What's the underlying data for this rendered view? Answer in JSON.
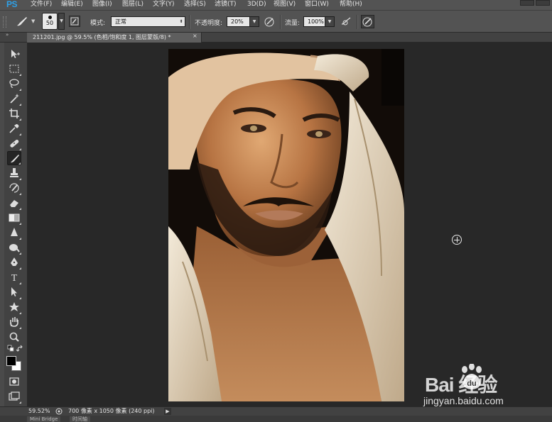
{
  "app": {
    "logo": "PS"
  },
  "menu": {
    "items": [
      {
        "label": "文件(F)"
      },
      {
        "label": "编辑(E)"
      },
      {
        "label": "图像(I)"
      },
      {
        "label": "图层(L)"
      },
      {
        "label": "文字(Y)"
      },
      {
        "label": "选择(S)"
      },
      {
        "label": "滤镜(T)"
      },
      {
        "label": "3D(D)"
      },
      {
        "label": "视图(V)"
      },
      {
        "label": "窗口(W)"
      },
      {
        "label": "帮助(H)"
      }
    ]
  },
  "options": {
    "brush_size": "50",
    "mode_label": "模式:",
    "mode_value": "正常",
    "opacity_label": "不透明度:",
    "opacity_value": "20%",
    "flow_label": "流量:",
    "flow_value": "100%"
  },
  "document": {
    "tab_title": "211201.jpg @ 59.5% (色相/饱和度 1, 图层蒙版/8) *",
    "close_glyph": "×"
  },
  "status": {
    "zoom": "59.52%",
    "doc_info": "700 像素 x 1050 像素 (240 ppi)",
    "arrow": "▶"
  },
  "bottom_panel": {
    "tabs": [
      "Mini Bridge",
      "时间轴"
    ]
  },
  "watermark": {
    "text": "Bai  经验",
    "url": "jingyan.baidu.com"
  },
  "tools": [
    {
      "icon": "move-tool-icon"
    },
    {
      "icon": "marquee-tool-icon"
    },
    {
      "icon": "lasso-tool-icon"
    },
    {
      "icon": "magic-wand-tool-icon"
    },
    {
      "icon": "crop-tool-icon"
    },
    {
      "icon": "eyedropper-tool-icon"
    },
    {
      "icon": "healing-brush-tool-icon"
    },
    {
      "icon": "brush-tool-icon"
    },
    {
      "icon": "clone-stamp-tool-icon"
    },
    {
      "icon": "history-brush-tool-icon"
    },
    {
      "icon": "eraser-tool-icon"
    },
    {
      "icon": "gradient-tool-icon"
    },
    {
      "icon": "blur-tool-icon"
    },
    {
      "icon": "dodge-tool-icon"
    },
    {
      "icon": "pen-tool-icon"
    },
    {
      "icon": "type-tool-icon"
    },
    {
      "icon": "path-selection-tool-icon"
    },
    {
      "icon": "shape-tool-icon"
    },
    {
      "icon": "hand-tool-icon"
    },
    {
      "icon": "zoom-tool-icon"
    }
  ],
  "colors": {
    "foreground": "#000000",
    "background": "#ffffff",
    "ps_blue": "#2fa0e6"
  }
}
